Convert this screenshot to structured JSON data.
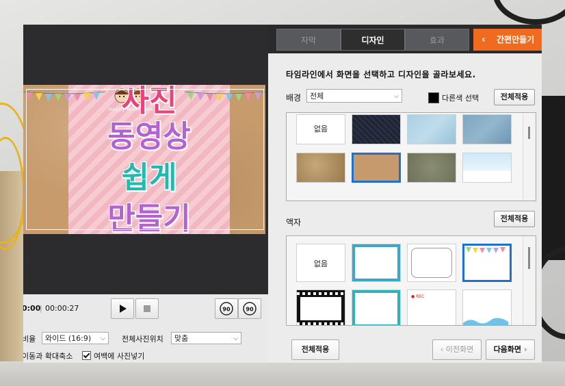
{
  "preview": {
    "tagline": "Happy Memories",
    "title_lines": [
      "사진",
      "동영상",
      "쉽게",
      "만들기"
    ],
    "time_current": "0:00",
    "time_total": "00:00:27",
    "replay_back_label": "90",
    "replay_fwd_label": "90"
  },
  "settings": {
    "ratio_label": "비율",
    "ratio_value": "와이드 (16:9)",
    "position_label": "전체사진위치",
    "position_value": "맞춤",
    "motion_label": "이동과 확대축소",
    "fill_label": "여백에 사진넣기"
  },
  "tabs": [
    "자막",
    "디자인",
    "효과"
  ],
  "easy_make_label": "간편만들기",
  "instruction": "타임라인에서 화면을 선택하고 디자인을 골라보세요.",
  "background": {
    "label": "배경",
    "filter_value": "전체",
    "other_color_label": "다른색 선택",
    "apply_all_label": "전체적용",
    "none_label": "없음"
  },
  "frame": {
    "label": "액자",
    "apply_all_label": "전체적용",
    "none_label": "없음",
    "rec_label": "● REC"
  },
  "footer": {
    "apply_all_label": "전체적용",
    "prev_label": "이전화면",
    "next_label": "다음화면"
  },
  "colors": {
    "accent": "#f06a1f",
    "selection": "#1f6fcf"
  }
}
